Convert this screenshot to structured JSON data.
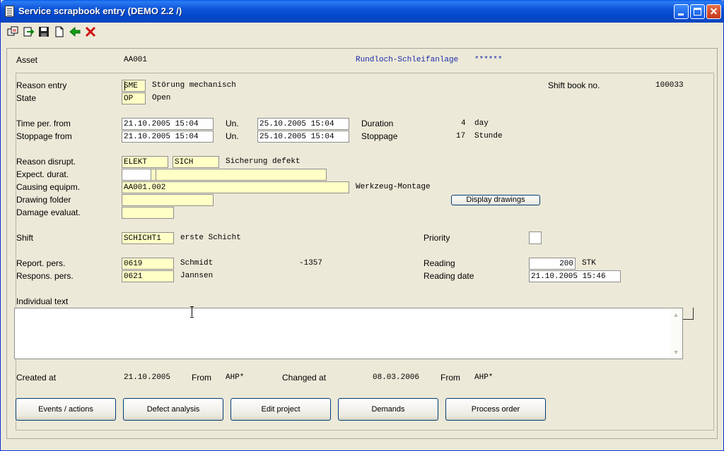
{
  "window": {
    "title": "Service scrapbook entry (DEMO 2.2 /)"
  },
  "toolbar": {
    "icons": [
      "copy-icon",
      "export-icon",
      "save-icon",
      "new-document-icon",
      "back-arrow-icon",
      "delete-icon"
    ]
  },
  "header": {
    "asset_label": "Asset",
    "asset_value": "AA001",
    "asset_desc": "Rundloch-Schleifanlage",
    "asset_stars": "******"
  },
  "form": {
    "reason_entry": {
      "label": "Reason entry",
      "code": "SME",
      "text": "Störung mechanisch"
    },
    "state": {
      "label": "State",
      "code": "OP",
      "text": "Open"
    },
    "shift_book": {
      "label": "Shift book no.",
      "value": "100033"
    },
    "time_per": {
      "label": "Time per. from",
      "from": "21.10.2005 15:04",
      "un_label": "Un.",
      "to": "25.10.2005 15:04"
    },
    "stoppage": {
      "label": "Stoppage from",
      "from": "21.10.2005 15:04",
      "un_label": "Un.",
      "to": "25.10.2005 15:04"
    },
    "duration": {
      "label": "Duration",
      "value": "4",
      "unit": "day"
    },
    "stoppage_dur": {
      "label": "Stoppage",
      "value": "17",
      "unit": "Stunde"
    },
    "reason_disrupt": {
      "label": "Reason disrupt.",
      "code1": "ELEKT",
      "code2": "SICH",
      "text": "Sicherung defekt"
    },
    "expect_durat": {
      "label": "Expect. durat.",
      "value1": "",
      "value2": ""
    },
    "causing_equip": {
      "label": "Causing equipm.",
      "value": "AA001.002",
      "text": "Werkzeug-Montage"
    },
    "drawing_folder": {
      "label": "Drawing folder",
      "value": ""
    },
    "display_drawings": "Display drawings",
    "damage_eval": {
      "label": "Damage evaluat.",
      "value": ""
    },
    "shift": {
      "label": "Shift",
      "code": "SCHICHT1",
      "text": "erste Schicht"
    },
    "priority": {
      "label": "Priority"
    },
    "report_pers": {
      "label": "Report. pers.",
      "code": "0619",
      "name": "Schmidt",
      "phone": "-1357"
    },
    "respons_pers": {
      "label": "Respons. pers.",
      "code": "0621",
      "name": "Jannsen"
    },
    "reading": {
      "label": "Reading",
      "value": "200",
      "unit": "STK"
    },
    "reading_date": {
      "label": "Reading date",
      "value": "21.10.2005 15:46"
    },
    "individual_text": {
      "label": "Individual text",
      "value": ""
    }
  },
  "footer": {
    "created_label": "Created at",
    "created_value": "21.10.2005",
    "from_label1": "From",
    "from_value1": "AHP*",
    "changed_label": "Changed at",
    "changed_value": "08.03.2006",
    "from_label2": "From",
    "from_value2": "AHP*"
  },
  "buttons": {
    "events": "Events / actions",
    "defect": "Defect analysis",
    "edit": "Edit project",
    "demands": "Demands",
    "process": "Process order"
  },
  "colors": {
    "field_bg": "#ffffc6",
    "window_bg": "#ece9d8",
    "title_blue": "#0348cc",
    "asset_desc": "#1b2aa8"
  }
}
